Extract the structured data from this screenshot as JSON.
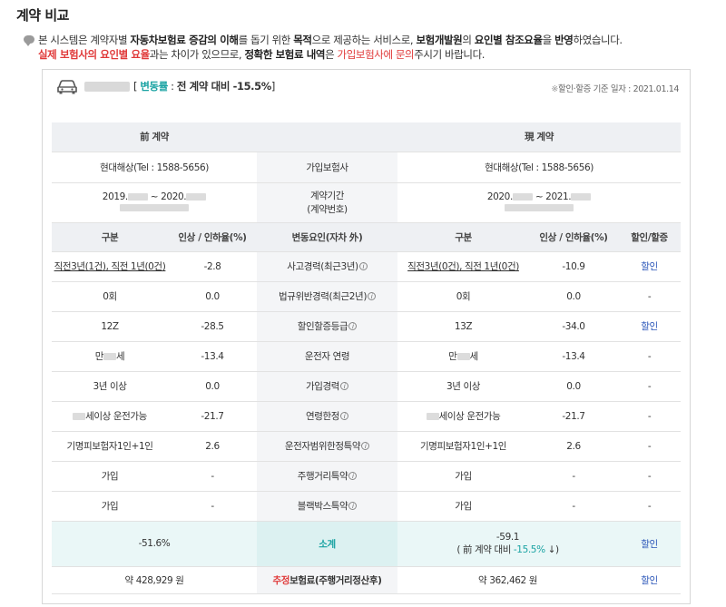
{
  "page": {
    "title": "계약 비교"
  },
  "notice": {
    "p1": "본 시스템은 계약자별 ",
    "b1": "자동차보험료 증감의 이해",
    "p2": "를 돕기 위한 ",
    "b2": "목적",
    "p3": "으로 제공하는 서비스로, ",
    "b3": "보험개발원",
    "p4": "의 ",
    "b4": "요인별 참조요율",
    "p5": "을 ",
    "b5": "반영",
    "p6": "하였습니다.",
    "r1": "실제 보험사의 요인별 요율",
    "p7": "과는 차이가 있으므로, ",
    "b6": "정확한 보험료 내역",
    "p8": "은 ",
    "r2": "가입보험사에 문의",
    "p9": "주시기 바랍니다."
  },
  "summary": {
    "rate_label": "변동률",
    "rate_sep": " : ",
    "rate_value": "전 계약 대비 -15.5%",
    "basis_mark": "※",
    "basis_text": "할인·할증 기준 일자 : 2021.01.14"
  },
  "table": {
    "prev_header": "前 계약",
    "curr_header": "現 계약",
    "insurer_label": "가입보험사",
    "prev_insurer": "현대해상(Tel : 1588-5656)",
    "curr_insurer": "현대해상(Tel : 1588-5656)",
    "period_label_1": "계약기간",
    "period_label_2": "(계약번호)",
    "prev_period_a": "2019.",
    "prev_period_b": " ~ 2020.",
    "curr_period_a": "2020.",
    "curr_period_b": " ~ 2021.",
    "col_category": "구분",
    "col_rate": "인상 / 인하율(%)",
    "col_factor": "변동요인(자차 外)",
    "col_discount": "할인/할증",
    "rows": [
      {
        "prev": "직전3년(1건), 직전 1년(0건)",
        "prev_rate": "-2.8",
        "factor": "사고경력(최근3년)",
        "curr": "직전3년(0건), 직전 1년(0건)",
        "curr_rate": "-10.9",
        "disc": "할인"
      },
      {
        "prev": "0회",
        "prev_rate": "0.0",
        "factor": "법규위반경력(최근2년)",
        "curr": "0회",
        "curr_rate": "0.0",
        "disc": "-"
      },
      {
        "prev": "12Z",
        "prev_rate": "-28.5",
        "factor": "할인할증등급",
        "curr": "13Z",
        "curr_rate": "-34.0",
        "disc": "할인"
      },
      {
        "prev_a": "만",
        "prev_b": "세",
        "prev_rate": "-13.4",
        "factor": "운전자 연령",
        "curr_a": "만",
        "curr_b": "세",
        "curr_rate": "-13.4",
        "disc": "-"
      },
      {
        "prev": "3년 이상",
        "prev_rate": "0.0",
        "factor": "가입경력",
        "curr": "3년 이상",
        "curr_rate": "0.0",
        "disc": "-"
      },
      {
        "prev": "세이상 운전가능",
        "prev_rate": "-21.7",
        "factor": "연령한정",
        "curr": "세이상 운전가능",
        "curr_rate": "-21.7",
        "disc": "-"
      },
      {
        "prev": "기명피보험자1인+1인",
        "prev_rate": "2.6",
        "factor": "운전자범위한정특약",
        "curr": "기명피보험자1인+1인",
        "curr_rate": "2.6",
        "disc": "-"
      },
      {
        "prev": "가입",
        "prev_rate": "-",
        "factor": "주행거리특약",
        "curr": "가입",
        "curr_rate": "-",
        "disc": "-"
      },
      {
        "prev": "가입",
        "prev_rate": "-",
        "factor": "블랙박스특약",
        "curr": "가입",
        "curr_rate": "-",
        "disc": "-"
      }
    ],
    "subtotal_label": "소계",
    "prev_subtotal": "-51.6%",
    "curr_subtotal": "-59.1",
    "curr_subtotal_note_a": "( 前 계약 대비 ",
    "curr_subtotal_note_b": "-15.5%",
    "curr_subtotal_note_c": " ↓)",
    "subtotal_disc": "할인",
    "premium_label_a": "추정",
    "premium_label_b": "보험료(주행거리정산후)",
    "prev_premium": "약 428,929 원",
    "curr_premium": "약 362,462 원",
    "premium_disc": "할인"
  },
  "colors": {
    "teal": "#1aa3a3",
    "red": "#e03a3a",
    "blue": "#2a55b8",
    "header_gray": "#eef0f3",
    "mint": "#eaf7f7"
  },
  "icons": {
    "notice": "speech-bubble-icon",
    "car": "car-icon",
    "info": "info-icon"
  }
}
